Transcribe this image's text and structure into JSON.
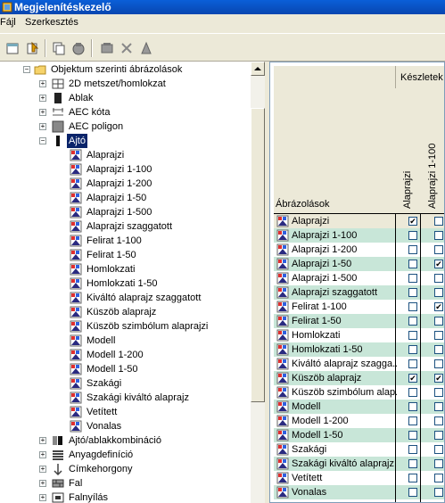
{
  "window": {
    "title": "Megjelenítéskezelő"
  },
  "menu": [
    "Fájl",
    "Szerkesztés"
  ],
  "toolbar": {
    "icons": [
      "new-icon",
      "import-icon",
      "copy-icon",
      "paste-icon",
      "purge-icon",
      "delete-icon",
      "update-icon"
    ]
  },
  "tree": {
    "root": "Objektum szerinti ábrázolások",
    "items": [
      {
        "label": "2D metszet/homlokzat",
        "icon": "section-icon",
        "expander": "+"
      },
      {
        "label": "Ablak",
        "icon": "window-icon",
        "expander": "+"
      },
      {
        "label": "AEC kóta",
        "icon": "dimension-icon",
        "expander": "+"
      },
      {
        "label": "AEC poligon",
        "icon": "polygon-icon",
        "expander": "+"
      },
      {
        "label": "Ajtó",
        "icon": "door-icon",
        "expander": "−",
        "selected": true
      }
    ],
    "door_children": [
      "Alaprajzi",
      "Alaprajzi 1-100",
      "Alaprajzi 1-200",
      "Alaprajzi 1-50",
      "Alaprajzi 1-500",
      "Alaprajzi szaggatott",
      "Felirat 1-100",
      "Felirat 1-50",
      "Homlokzati",
      "Homlokzati 1-50",
      "Kiváltó alaprajz szaggatott",
      "Küszöb alaprajz",
      "Küszöb szimbólum alaprajzi",
      "Modell",
      "Modell 1-200",
      "Modell 1-50",
      "Szakági",
      "Szakági kiváltó alaprajz",
      "Vetített",
      "Vonalas"
    ],
    "after_items": [
      {
        "label": "Ajtó/ablakkombináció",
        "icon": "door-window-icon",
        "expander": "+"
      },
      {
        "label": "Anyagdefiníció",
        "icon": "material-icon",
        "expander": "+"
      },
      {
        "label": "Címkehorgony",
        "icon": "anchor-icon",
        "expander": "+"
      },
      {
        "label": "Fal",
        "icon": "wall-icon",
        "expander": "+"
      },
      {
        "label": "Falnyílás",
        "icon": "opening-icon",
        "expander": "+"
      }
    ]
  },
  "grid": {
    "group_header": "Készletek",
    "row_header": "Ábrázolások",
    "columns": [
      "Alaprajzi",
      "Alaprajzi 1-100"
    ],
    "rows": [
      {
        "label": "Alaprajzi",
        "checks": [
          true,
          false
        ],
        "shaded": false,
        "current": true
      },
      {
        "label": "Alaprajzi 1-100",
        "checks": [
          false,
          false
        ],
        "shaded": true
      },
      {
        "label": "Alaprajzi 1-200",
        "checks": [
          false,
          false
        ],
        "shaded": false
      },
      {
        "label": "Alaprajzi 1-50",
        "checks": [
          false,
          true
        ],
        "shaded": true
      },
      {
        "label": "Alaprajzi 1-500",
        "checks": [
          false,
          false
        ],
        "shaded": false
      },
      {
        "label": "Alaprajzi szaggatott",
        "checks": [
          false,
          false
        ],
        "shaded": true
      },
      {
        "label": "Felirat 1-100",
        "checks": [
          false,
          true
        ],
        "shaded": false
      },
      {
        "label": "Felirat 1-50",
        "checks": [
          false,
          false
        ],
        "shaded": true
      },
      {
        "label": "Homlokzati",
        "checks": [
          false,
          false
        ],
        "shaded": false
      },
      {
        "label": "Homlokzati 1-50",
        "checks": [
          false,
          false
        ],
        "shaded": true
      },
      {
        "label": "Kiváltó alaprajz szagga...",
        "checks": [
          false,
          false
        ],
        "shaded": false
      },
      {
        "label": "Küszöb alaprajz",
        "checks": [
          true,
          true
        ],
        "shaded": true
      },
      {
        "label": "Küszöb szimbólum alap...",
        "checks": [
          false,
          false
        ],
        "shaded": false
      },
      {
        "label": "Modell",
        "checks": [
          false,
          false
        ],
        "shaded": true
      },
      {
        "label": "Modell 1-200",
        "checks": [
          false,
          false
        ],
        "shaded": false
      },
      {
        "label": "Modell 1-50",
        "checks": [
          false,
          false
        ],
        "shaded": true
      },
      {
        "label": "Szakági",
        "checks": [
          false,
          false
        ],
        "shaded": false
      },
      {
        "label": "Szakági kiváltó alaprajz",
        "checks": [
          false,
          false
        ],
        "shaded": true
      },
      {
        "label": "Vetített",
        "checks": [
          false,
          false
        ],
        "shaded": false
      },
      {
        "label": "Vonalas",
        "checks": [
          false,
          false
        ],
        "shaded": true
      }
    ]
  },
  "colors": {
    "selection": "#0a246a",
    "row_shade": "#c8e6d8",
    "title_bar": "#0a5fd8",
    "checkmark": "#000000"
  }
}
